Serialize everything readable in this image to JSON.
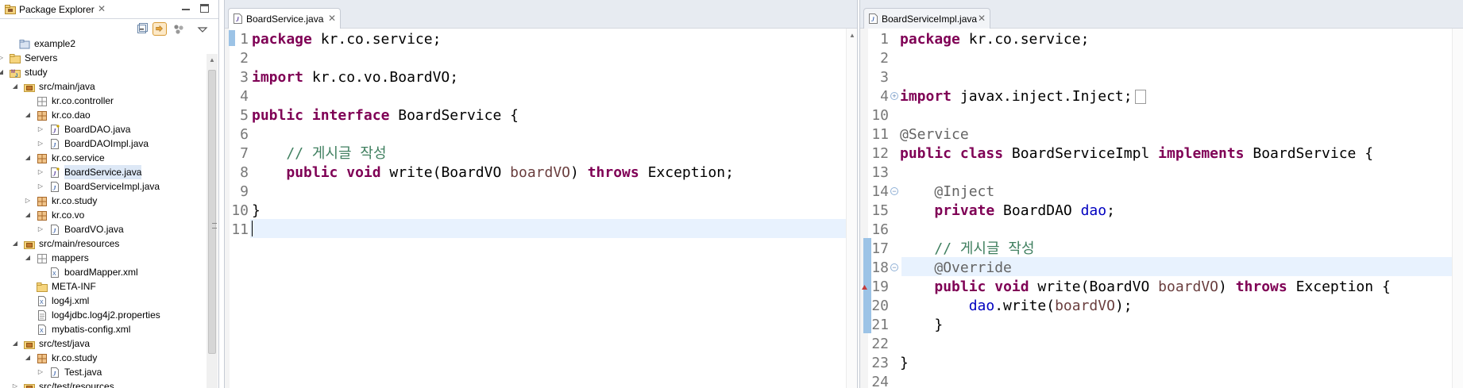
{
  "explorer": {
    "title": "Package Explorer",
    "tree": [
      {
        "label": "example2",
        "icon": "project-closed-icon",
        "expand": "none",
        "selected": false
      },
      {
        "label": "Servers",
        "icon": "folder-icon",
        "expand": "collapsed",
        "selected": false
      },
      {
        "label": "study",
        "icon": "maven-project-icon",
        "expand": "expanded",
        "selected": false
      },
      {
        "label": "src/main/java",
        "icon": "source-folder-icon",
        "expand": "expanded",
        "selected": false
      },
      {
        "label": "kr.co.controller",
        "icon": "empty-package-icon",
        "expand": "none",
        "selected": false
      },
      {
        "label": "kr.co.dao",
        "icon": "package-icon",
        "expand": "expanded",
        "selected": false
      },
      {
        "label": "BoardDAO.java",
        "icon": "java-interface-file-icon",
        "expand": "collapsed",
        "selected": false
      },
      {
        "label": "BoardDAOImpl.java",
        "icon": "java-file-icon",
        "expand": "collapsed",
        "selected": false
      },
      {
        "label": "kr.co.service",
        "icon": "package-icon",
        "expand": "expanded",
        "selected": false
      },
      {
        "label": "BoardService.java",
        "icon": "java-interface-file-icon",
        "expand": "collapsed",
        "selected": true
      },
      {
        "label": "BoardServiceImpl.java",
        "icon": "java-file-icon",
        "expand": "collapsed",
        "selected": false
      },
      {
        "label": "kr.co.study",
        "icon": "package-icon",
        "expand": "collapsed",
        "selected": false
      },
      {
        "label": "kr.co.vo",
        "icon": "package-icon",
        "expand": "expanded",
        "selected": false
      },
      {
        "label": "BoardVO.java",
        "icon": "java-file-icon",
        "expand": "collapsed",
        "selected": false
      },
      {
        "label": "src/main/resources",
        "icon": "source-folder-icon",
        "expand": "expanded",
        "selected": false
      },
      {
        "label": "mappers",
        "icon": "empty-package-icon",
        "expand": "expanded",
        "selected": false
      },
      {
        "label": "boardMapper.xml",
        "icon": "xml-file-icon",
        "expand": "none",
        "selected": false
      },
      {
        "label": "META-INF",
        "icon": "folder-icon",
        "expand": "none",
        "selected": false
      },
      {
        "label": "log4j.xml",
        "icon": "xml-file-icon",
        "expand": "none",
        "selected": false
      },
      {
        "label": "log4jdbc.log4j2.properties",
        "icon": "properties-file-icon",
        "expand": "none",
        "selected": false
      },
      {
        "label": "mybatis-config.xml",
        "icon": "xml-file-icon",
        "expand": "none",
        "selected": false
      },
      {
        "label": "src/test/java",
        "icon": "source-folder-icon",
        "expand": "expanded",
        "selected": false
      },
      {
        "label": "kr.co.study",
        "icon": "package-icon",
        "expand": "expanded",
        "selected": false
      },
      {
        "label": "Test.java",
        "icon": "java-file-icon",
        "expand": "collapsed",
        "selected": false
      },
      {
        "label": "src/test/resources",
        "icon": "source-folder-icon",
        "expand": "collapsed",
        "selected": false
      }
    ]
  },
  "editor_left": {
    "tab_label": "BoardService.java",
    "line_numbers": [
      "1",
      "2",
      "3",
      "4",
      "5",
      "6",
      "7",
      "8",
      "9",
      "10",
      "11"
    ],
    "lines": [
      [
        {
          "t": "package",
          "s": "kw"
        },
        {
          "t": " kr.co.service;"
        }
      ],
      [],
      [
        {
          "t": "import",
          "s": "kw"
        },
        {
          "t": " kr.co.vo.BoardVO;"
        }
      ],
      [],
      [
        {
          "t": "public",
          "s": "kw"
        },
        {
          "t": " "
        },
        {
          "t": "interface",
          "s": "kw"
        },
        {
          "t": " BoardService {"
        }
      ],
      [],
      [
        {
          "t": "    "
        },
        {
          "t": "// 게시글 작성",
          "s": "cm"
        }
      ],
      [
        {
          "t": "    "
        },
        {
          "t": "public",
          "s": "kw"
        },
        {
          "t": " "
        },
        {
          "t": "void",
          "s": "kw"
        },
        {
          "t": " write(BoardVO "
        },
        {
          "t": "boardVO",
          "s": "pv"
        },
        {
          "t": ") "
        },
        {
          "t": "throws",
          "s": "kw"
        },
        {
          "t": " Exception;"
        }
      ],
      [],
      [
        {
          "t": "}"
        }
      ],
      []
    ]
  },
  "editor_right": {
    "tab_label": "BoardServiceImpl.java",
    "line_numbers": [
      "1",
      "2",
      "3",
      "4",
      "10",
      "11",
      "12",
      "13",
      "14",
      "15",
      "16",
      "17",
      "18",
      "19",
      "20",
      "21",
      "22",
      "23",
      "24"
    ],
    "lines": [
      [
        {
          "t": "package",
          "s": "kw"
        },
        {
          "t": " kr.co.service;"
        }
      ],
      [],
      [],
      [
        {
          "t": "import",
          "s": "kw"
        },
        {
          "t": " javax.inject.Inject;"
        }
      ],
      [],
      [
        {
          "t": "@Service",
          "s": "an"
        }
      ],
      [
        {
          "t": "public",
          "s": "kw"
        },
        {
          "t": " "
        },
        {
          "t": "class",
          "s": "kw"
        },
        {
          "t": " BoardServiceImpl "
        },
        {
          "t": "implements",
          "s": "kw"
        },
        {
          "t": " BoardService {"
        }
      ],
      [],
      [
        {
          "t": "    "
        },
        {
          "t": "@Inject",
          "s": "an"
        }
      ],
      [
        {
          "t": "    "
        },
        {
          "t": "private",
          "s": "kw"
        },
        {
          "t": " BoardDAO "
        },
        {
          "t": "dao",
          "s": "fld"
        },
        {
          "t": ";"
        }
      ],
      [],
      [
        {
          "t": "    "
        },
        {
          "t": "// 게시글 작성",
          "s": "cm"
        }
      ],
      [
        {
          "t": "    "
        },
        {
          "t": "@Override",
          "s": "an"
        }
      ],
      [
        {
          "t": "    "
        },
        {
          "t": "public",
          "s": "kw"
        },
        {
          "t": " "
        },
        {
          "t": "void",
          "s": "kw"
        },
        {
          "t": " write(BoardVO "
        },
        {
          "t": "boardVO",
          "s": "pv"
        },
        {
          "t": ") "
        },
        {
          "t": "throws",
          "s": "kw"
        },
        {
          "t": " Exception {"
        }
      ],
      [
        {
          "t": "        "
        },
        {
          "t": "dao",
          "s": "fld"
        },
        {
          "t": ".write("
        },
        {
          "t": "boardVO",
          "s": "pv"
        },
        {
          "t": ");"
        }
      ],
      [
        {
          "t": "    }"
        }
      ],
      [],
      [
        {
          "t": "}"
        }
      ],
      []
    ]
  },
  "colors": {
    "keyword": "#7f0055",
    "comment": "#3f7f5f",
    "annotation": "#646464",
    "parameter": "#6a3e3e",
    "field": "#0000c0",
    "current_line": "#e8f2fe",
    "selection": "#dde8f6"
  }
}
